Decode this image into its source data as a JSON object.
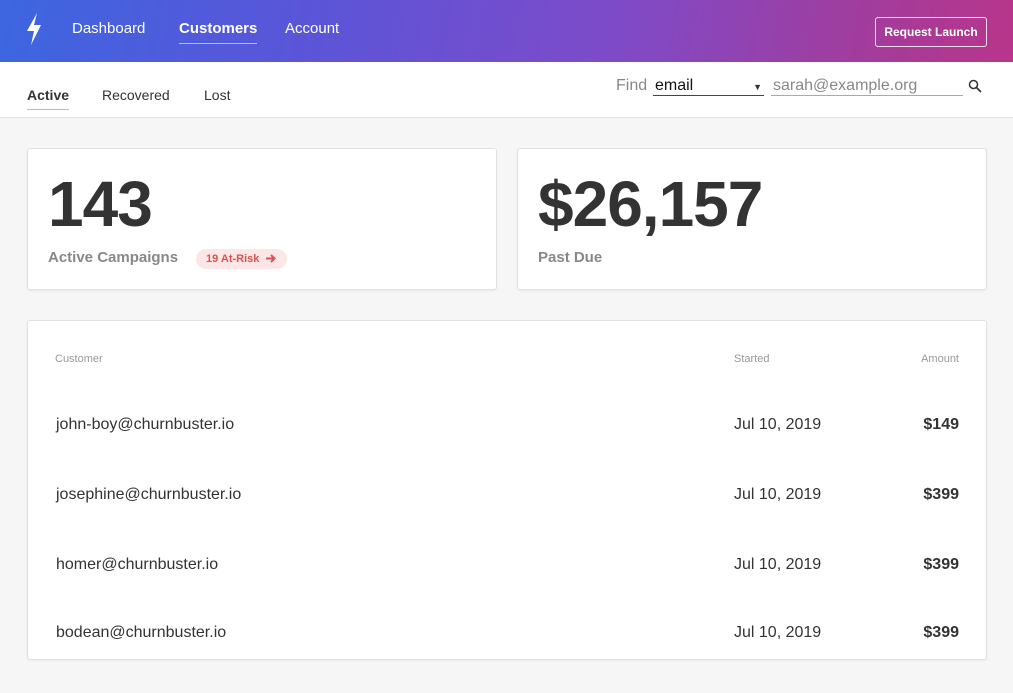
{
  "header": {
    "nav": [
      {
        "label": "Dashboard"
      },
      {
        "label": "Customers"
      },
      {
        "label": "Account"
      }
    ],
    "request_button": "Request Launch"
  },
  "subnav": {
    "tabs": [
      {
        "label": "Active"
      },
      {
        "label": "Recovered"
      },
      {
        "label": "Lost"
      }
    ],
    "find_label": "Find",
    "find_field": "email",
    "search_placeholder": "sarah@example.org"
  },
  "stats": {
    "campaigns": {
      "value": "143",
      "label": "Active Campaigns",
      "badge": "19 At-Risk"
    },
    "past_due": {
      "value": "$26,157",
      "label": "Past Due"
    }
  },
  "table": {
    "headers": {
      "customer": "Customer",
      "started": "Started",
      "amount": "Amount"
    },
    "rows": [
      {
        "customer": "john-boy@churnbuster.io",
        "started": "Jul 10, 2019",
        "amount": "$149"
      },
      {
        "customer": "josephine@churnbuster.io",
        "started": "Jul 10, 2019",
        "amount": "$399"
      },
      {
        "customer": "homer@churnbuster.io",
        "started": "Jul 10, 2019",
        "amount": "$399"
      },
      {
        "customer": "bodean@churnbuster.io",
        "started": "Jul 10, 2019",
        "amount": "$399"
      }
    ]
  },
  "colors": {
    "gradient_start": "#3d66e0",
    "gradient_end": "#b8358a",
    "badge_text": "#d9534f",
    "badge_bg": "#fde6e6"
  },
  "icons": {
    "logo": "lightning-bolt-icon",
    "search": "search-icon",
    "badge_arrow": "arrow-right-icon"
  }
}
